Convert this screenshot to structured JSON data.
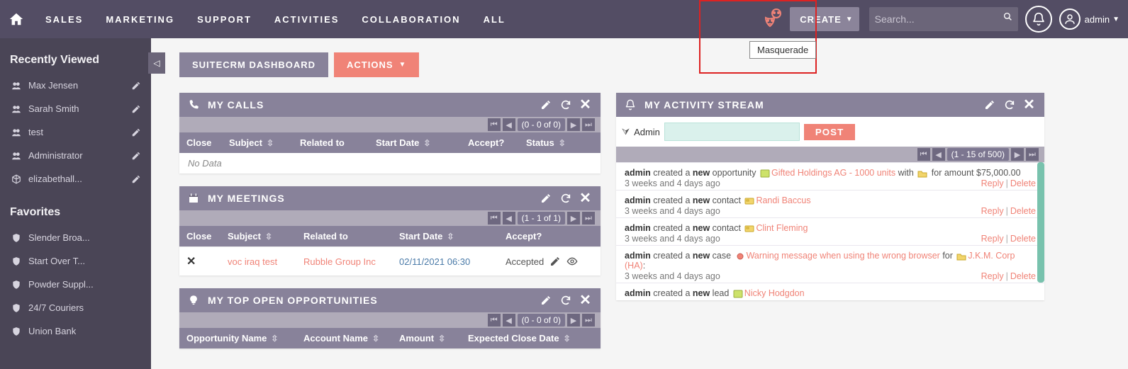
{
  "nav": {
    "items": [
      "SALES",
      "MARKETING",
      "SUPPORT",
      "ACTIVITIES",
      "COLLABORATION",
      "ALL"
    ],
    "create": "CREATE",
    "search_placeholder": "Search...",
    "username": "admin",
    "tooltip": "Masquerade"
  },
  "sidebar": {
    "recently_title": "Recently Viewed",
    "recently": [
      "Max Jensen",
      "Sarah Smith",
      "test",
      "Administrator",
      "elizabethall..."
    ],
    "favorites_title": "Favorites",
    "favorites": [
      "Slender Broa...",
      "Start Over T...",
      "Powder Suppl...",
      "24/7 Couriers",
      "Union Bank"
    ]
  },
  "tabs": {
    "dashboard": "SUITECRM DASHBOARD",
    "actions": "ACTIONS"
  },
  "calls": {
    "title": "MY CALLS",
    "pager": "(0 - 0 of 0)",
    "headers": [
      "Close",
      "Subject",
      "Related to",
      "Start Date",
      "Accept?",
      "Status"
    ],
    "nodata": "No Data"
  },
  "meetings": {
    "title": "MY MEETINGS",
    "pager": "(1 - 1 of 1)",
    "headers": [
      "Close",
      "Subject",
      "Related to",
      "Start Date",
      "Accept?"
    ],
    "row": {
      "subject": "voc iraq test",
      "related": "Rubble Group Inc",
      "start_date": "02/11/2021 06:30",
      "accept": "Accepted"
    }
  },
  "opps": {
    "title": "MY TOP OPEN OPPORTUNITIES",
    "pager": "(0 - 0 of 0)",
    "headers": [
      "Opportunity Name",
      "Account Name",
      "Amount",
      "Expected Close Date"
    ]
  },
  "activity": {
    "title": "MY ACTIVITY STREAM",
    "user": "Admin",
    "post": "POST",
    "pager": "(1 - 15 of 500)",
    "reply": "Reply",
    "delete": "Delete",
    "feed": [
      {
        "user": "admin",
        "t1": " created a ",
        "b": "new",
        "t2": " opportunity ",
        "link": "Gifted Holdings AG - 1000 units",
        "mid": " with ",
        "tail": " for amount $75,000.00",
        "time": "3 weeks and 4 days ago"
      },
      {
        "user": "admin",
        "t1": " created a ",
        "b": "new",
        "t2": " contact ",
        "link": "Randi Baccus",
        "mid": "",
        "tail": "",
        "time": "3 weeks and 4 days ago"
      },
      {
        "user": "admin",
        "t1": " created a ",
        "b": "new",
        "t2": " contact ",
        "link": "Clint Fleming",
        "mid": "",
        "tail": "",
        "time": "3 weeks and 4 days ago"
      },
      {
        "user": "admin",
        "t1": " created a ",
        "b": "new",
        "t2": " case ",
        "link": "Warning message when using the wrong browser",
        "mid": " for ",
        "tail_link": "J.K.M. Corp (HA)",
        "tail": ":",
        "time": "3 weeks and 4 days ago"
      },
      {
        "user": "admin",
        "t1": " created a ",
        "b": "new",
        "t2": " lead ",
        "link": "Nicky Hodgdon",
        "mid": "",
        "tail": "",
        "time": ""
      }
    ]
  }
}
